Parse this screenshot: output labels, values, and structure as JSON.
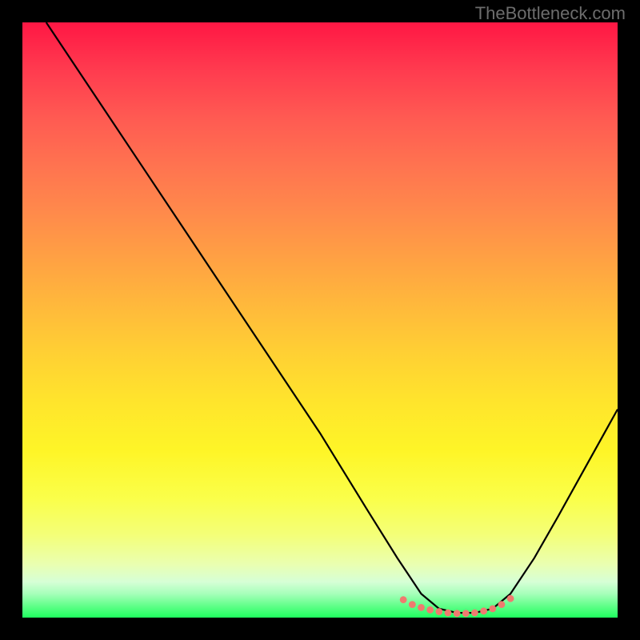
{
  "watermark": "TheBottleneck.com",
  "chart_data": {
    "type": "line",
    "title": "",
    "xlabel": "",
    "ylabel": "",
    "xlim": [
      0,
      100
    ],
    "ylim": [
      0,
      100
    ],
    "series": [
      {
        "name": "bottleneck-curve",
        "values": [
          {
            "x": 4,
            "y": 100
          },
          {
            "x": 10,
            "y": 91
          },
          {
            "x": 20,
            "y": 76
          },
          {
            "x": 30,
            "y": 61
          },
          {
            "x": 40,
            "y": 46
          },
          {
            "x": 50,
            "y": 31
          },
          {
            "x": 58,
            "y": 18
          },
          {
            "x": 63,
            "y": 10
          },
          {
            "x": 67,
            "y": 4
          },
          {
            "x": 70,
            "y": 1.5
          },
          {
            "x": 73,
            "y": 0.8
          },
          {
            "x": 76,
            "y": 0.8
          },
          {
            "x": 79,
            "y": 1.5
          },
          {
            "x": 82,
            "y": 4
          },
          {
            "x": 86,
            "y": 10
          },
          {
            "x": 90,
            "y": 17
          },
          {
            "x": 95,
            "y": 26
          },
          {
            "x": 100,
            "y": 35
          }
        ]
      }
    ],
    "dotted_segment": {
      "name": "dotted-bottom",
      "values": [
        {
          "x": 64,
          "y": 3.0
        },
        {
          "x": 65.5,
          "y": 2.2
        },
        {
          "x": 67,
          "y": 1.7
        },
        {
          "x": 68.5,
          "y": 1.3
        },
        {
          "x": 70,
          "y": 1.0
        },
        {
          "x": 71.5,
          "y": 0.8
        },
        {
          "x": 73,
          "y": 0.7
        },
        {
          "x": 74.5,
          "y": 0.7
        },
        {
          "x": 76,
          "y": 0.8
        },
        {
          "x": 77.5,
          "y": 1.1
        },
        {
          "x": 79,
          "y": 1.5
        },
        {
          "x": 80.5,
          "y": 2.2
        },
        {
          "x": 82,
          "y": 3.2
        }
      ]
    },
    "gradient_stops": [
      {
        "pos": 0,
        "color": "#ff1744"
      },
      {
        "pos": 50,
        "color": "#ffd633"
      },
      {
        "pos": 85,
        "color": "#faff4a"
      },
      {
        "pos": 100,
        "color": "#1fff5f"
      }
    ]
  }
}
